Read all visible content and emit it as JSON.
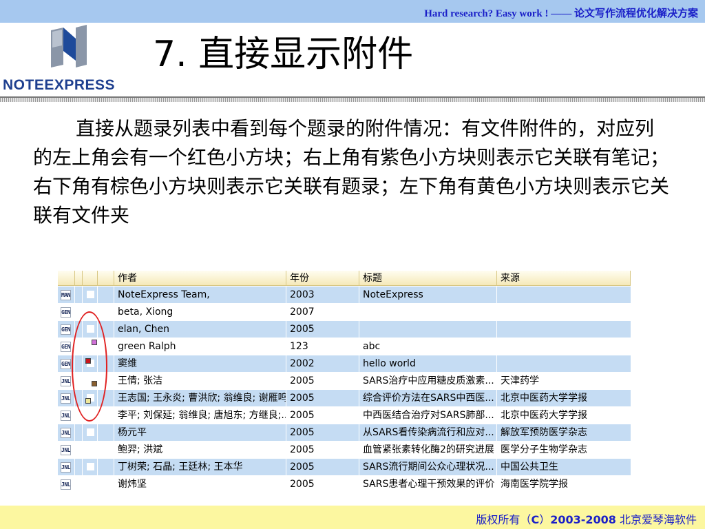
{
  "header": {
    "banner_text": "Hard research? Easy work !   ——   论文写作流程优化解决方案",
    "logo_text": "NOTEEXPRESS"
  },
  "slide": {
    "title": "7. 直接显示附件",
    "body": "直接从题录列表中看到每个题录的附件情况：有文件附件的，对应列的左上角会有一个红色小方块；右上角有紫色小方块则表示它关联有笔记；右下角有棕色小方块则表示它关联有题录；左下角有黄色小方块则表示它关联有文件夹"
  },
  "table": {
    "columns": [
      "作者",
      "年份",
      "标题",
      "来源"
    ],
    "rows": [
      {
        "type": "MAN",
        "author": "NoteExpress Team,",
        "year": "2003",
        "title": "NoteExpress",
        "source": "",
        "marker": "",
        "marker_color": ""
      },
      {
        "type": "GEN",
        "author": "beta, Xiong",
        "year": "2007",
        "title": "",
        "source": "",
        "marker": "",
        "marker_color": ""
      },
      {
        "type": "GEN",
        "author": "elan, Chen",
        "year": "2005",
        "title": "",
        "source": "",
        "marker": "",
        "marker_color": ""
      },
      {
        "type": "GEN",
        "author": "green Ralph",
        "year": "123",
        "title": "abc",
        "source": "",
        "marker": "top-right",
        "marker_color": "#d070d8"
      },
      {
        "type": "GEN",
        "author": "窦维",
        "year": "2002",
        "title": "hello world",
        "source": "",
        "marker": "top-left",
        "marker_color": "#c8161d"
      },
      {
        "type": "JNL",
        "author": "王倩; 张洁",
        "year": "2005",
        "title": "SARS治疗中应用糖皮质激素...",
        "source": "天津药学",
        "marker": "bottom-right",
        "marker_color": "#8a6030"
      },
      {
        "type": "JNL",
        "author": "王志国; 王永炎; 曹洪欣; 翁维良; 谢雁鸣",
        "year": "2005",
        "title": "综合评价方法在SARS中西医...",
        "source": "北京中医药大学学报",
        "marker": "bottom-left",
        "marker_color": "#f0e898"
      },
      {
        "type": "JNL",
        "author": "李平; 刘保延; 翁维良; 唐旭东; 方继良;...",
        "year": "2005",
        "title": "中西医结合治疗对SARS肺部...",
        "source": "北京中医药大学学报",
        "marker": "",
        "marker_color": ""
      },
      {
        "type": "JNL",
        "author": "杨元平",
        "year": "2005",
        "title": "从SARS看传染病流行和应对...",
        "source": "解放军预防医学杂志",
        "marker": "",
        "marker_color": ""
      },
      {
        "type": "JNL",
        "author": "鲍羿; 洪斌",
        "year": "2005",
        "title": "血管紧张素转化酶2的研究进展",
        "source": "医学分子生物学杂志",
        "marker": "",
        "marker_color": ""
      },
      {
        "type": "JNL",
        "author": "丁树荣; 石晶; 王廷林; 王本华",
        "year": "2005",
        "title": "SARS流行期间公众心理状况...",
        "source": "中国公共卫生",
        "marker": "",
        "marker_color": ""
      },
      {
        "type": "JNL",
        "author": "谢炜坚",
        "year": "2005",
        "title": "SARS患者心理干预效果的评价",
        "source": "海南医学院学报",
        "marker": "",
        "marker_color": ""
      }
    ]
  },
  "footer": {
    "prefix": "版权所有（",
    "c": "C",
    "mid": "）",
    "years": "2003-2008",
    "suffix": " 北京爱琴海软件"
  },
  "colors": {
    "banner": "#a6c8ef",
    "link_blue": "#1a1fc8",
    "footer_band": "#fcf7a0",
    "row_blue": "#c5dcf3",
    "annotation_red": "#e02020"
  }
}
